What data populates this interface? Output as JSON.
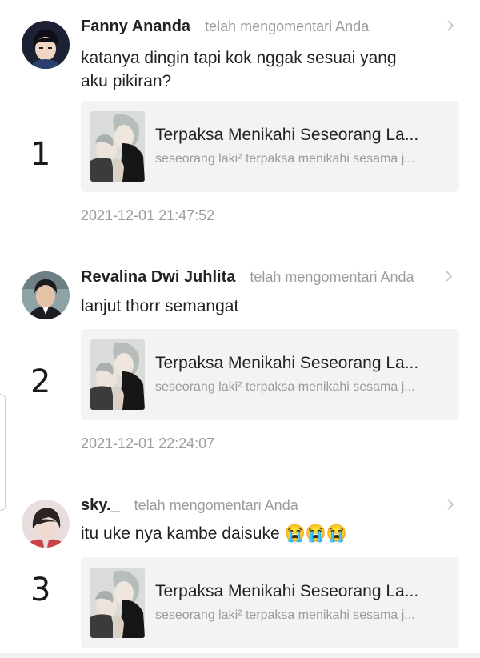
{
  "notifications": [
    {
      "number": "1",
      "username": "Fanny Ananda",
      "action": "telah mengomentari Anda",
      "comment_lines": [
        "katanya dingin tapi kok nggak sesuai yang",
        "aku pikiran?"
      ],
      "card_title": "Terpaksa Menikahi Seseorang La...",
      "card_desc": "seseorang laki² terpaksa menikahi sesama j...",
      "timestamp": "2021-12-01 21:47:52",
      "avatar_icon": "anime-boy-avatar"
    },
    {
      "number": "2",
      "username": "Revalina Dwi Juhlita",
      "action": "telah mengomentari Anda",
      "comment_lines": [
        "lanjut thorr semangat"
      ],
      "card_title": "Terpaksa Menikahi Seseorang La...",
      "card_desc": "seseorang laki² terpaksa menikahi sesama j...",
      "timestamp": "2021-12-01 22:24:07",
      "avatar_icon": "man-portrait-avatar"
    },
    {
      "number": "3",
      "username": "sky._",
      "action": "telah mengomentari Anda",
      "comment_lines": [
        "itu uke nya kambe daisuke 😭😭😭"
      ],
      "card_title": "Terpaksa Menikahi Seseorang La...",
      "card_desc": "seseorang laki² terpaksa menikahi sesama j...",
      "timestamp": "",
      "avatar_icon": "anime-character-avatar"
    }
  ],
  "colors": {
    "muted_text": "#9b9b9b",
    "card_bg": "#f3f3f3",
    "divider": "#e6e6e6"
  }
}
